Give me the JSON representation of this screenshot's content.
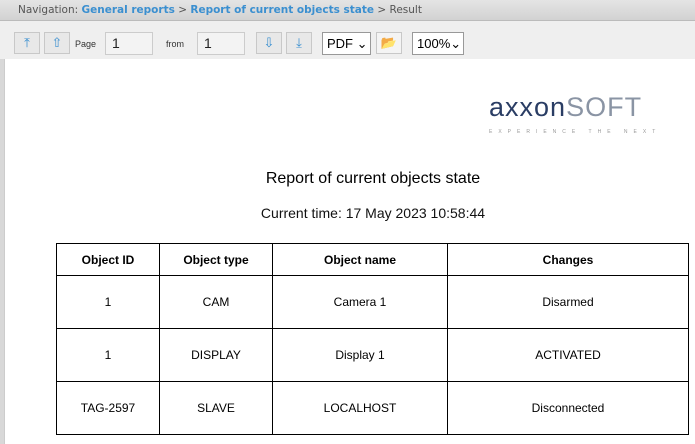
{
  "nav": {
    "prefix": "Navigation:",
    "link1": "General reports",
    "link2": "Report of current objects state",
    "current": "Result",
    "sep": ">"
  },
  "toolbar": {
    "page_label": "Page",
    "page_value": "1",
    "from_label": "from",
    "from_value": "1",
    "format": "PDF",
    "zoom": "100%"
  },
  "report": {
    "logo_main": "axxon",
    "logo_soft": "SOFT",
    "logo_tagline": "EXPERIENCE THE NEXT",
    "title": "Report of current objects state",
    "time": "Current time: 17 May 2023 10:58:44",
    "headers": [
      "Object ID",
      "Object type",
      "Object name",
      "Changes"
    ],
    "rows": [
      [
        "1",
        "CAM",
        "Camera 1",
        "Disarmed"
      ],
      [
        "1",
        "DISPLAY",
        "Display 1",
        "ACTIVATED"
      ],
      [
        "TAG-2597",
        "SLAVE",
        "LOCALHOST",
        "Disconnected"
      ]
    ]
  }
}
